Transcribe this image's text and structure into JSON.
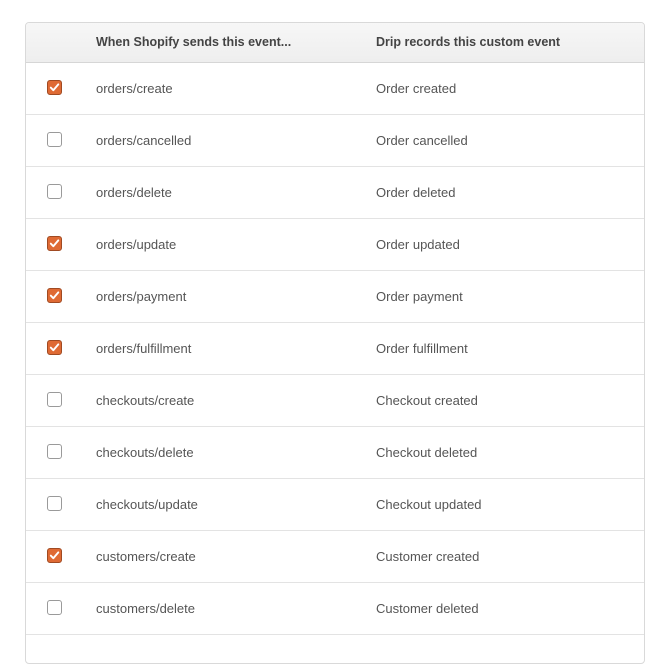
{
  "table": {
    "header": {
      "shopify_event": "When Shopify sends this event...",
      "drip_event": "Drip records this custom event"
    },
    "rows": [
      {
        "checked": true,
        "shopify_event": "orders/create",
        "drip_event": "Order created"
      },
      {
        "checked": false,
        "shopify_event": "orders/cancelled",
        "drip_event": "Order cancelled"
      },
      {
        "checked": false,
        "shopify_event": "orders/delete",
        "drip_event": "Order deleted"
      },
      {
        "checked": true,
        "shopify_event": "orders/update",
        "drip_event": "Order updated"
      },
      {
        "checked": true,
        "shopify_event": "orders/payment",
        "drip_event": "Order payment"
      },
      {
        "checked": true,
        "shopify_event": "orders/fulfillment",
        "drip_event": "Order fulfillment"
      },
      {
        "checked": false,
        "shopify_event": "checkouts/create",
        "drip_event": "Checkout created"
      },
      {
        "checked": false,
        "shopify_event": "checkouts/delete",
        "drip_event": "Checkout deleted"
      },
      {
        "checked": false,
        "shopify_event": "checkouts/update",
        "drip_event": "Checkout updated"
      },
      {
        "checked": true,
        "shopify_event": "customers/create",
        "drip_event": "Customer created"
      },
      {
        "checked": false,
        "shopify_event": "customers/delete",
        "drip_event": "Customer deleted"
      }
    ]
  },
  "colors": {
    "checkbox_checked": "#df6a34",
    "checkbox_border": "#9a9a9a"
  }
}
